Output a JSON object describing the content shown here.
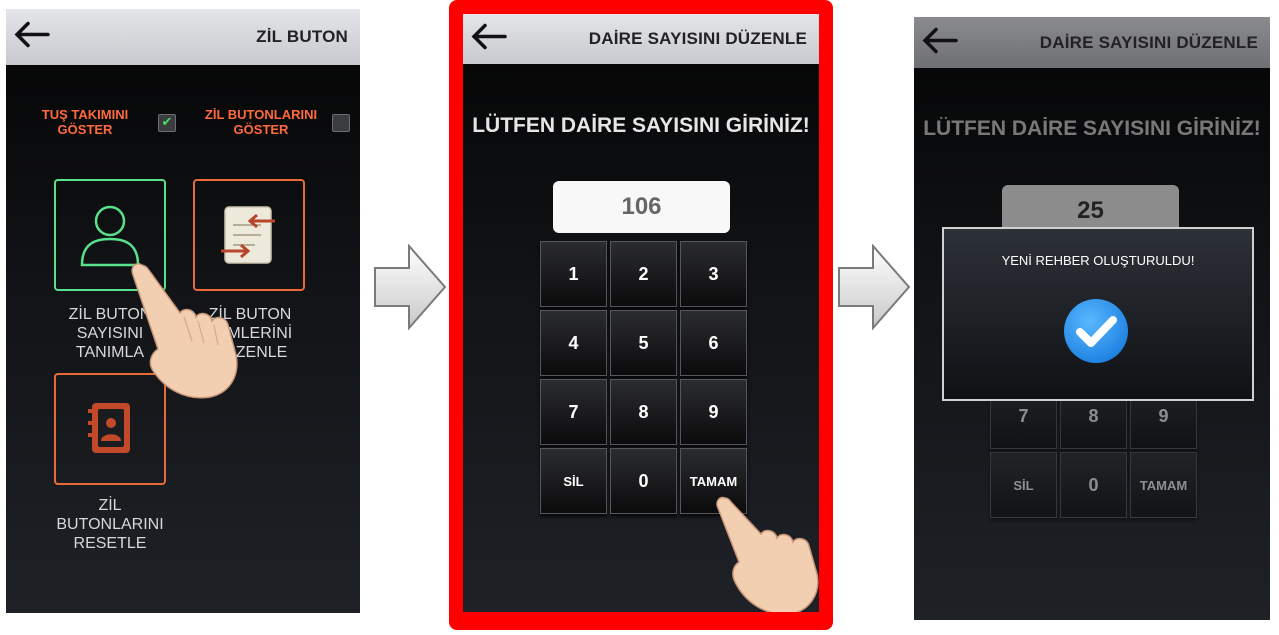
{
  "screen1": {
    "title": "ZİL BUTON",
    "toggle_keypad_label": "TUŞ TAKIMINI GÖSTER",
    "toggle_keypad_checked": true,
    "toggle_buttons_label": "ZİL BUTONLARINI GÖSTER",
    "toggle_buttons_checked": false,
    "tiles": [
      {
        "label": "ZİL BUTON SAYISINI TANIMLA"
      },
      {
        "label": "ZİL BUTON İSİMLERİNİ DÜZENLE"
      },
      {
        "label": "ZİL BUTONLARINI RESETLE"
      }
    ]
  },
  "screen2": {
    "title": "DAİRE SAYISINI DÜZENLE",
    "prompt": "LÜTFEN DAİRE SAYISINI GİRİNİZ!",
    "value": "106",
    "keys": [
      "1",
      "2",
      "3",
      "4",
      "5",
      "6",
      "7",
      "8",
      "9",
      "SİL",
      "0",
      "TAMAM"
    ]
  },
  "screen3": {
    "title": "DAİRE SAYISINI DÜZENLE",
    "prompt": "LÜTFEN DAİRE SAYISINI GİRİNİZ!",
    "value": "25",
    "keys_visible": [
      "7",
      "8",
      "9",
      "SİL",
      "0",
      "TAMAM"
    ],
    "dialog_message": "YENİ REHBER OLUŞTURULDU!"
  },
  "colors": {
    "highlight_frame": "#ff0000",
    "tile_border": "#e86a3a",
    "tile_selected_border": "#58e08c",
    "check_icon_bg": "#2196f3"
  }
}
